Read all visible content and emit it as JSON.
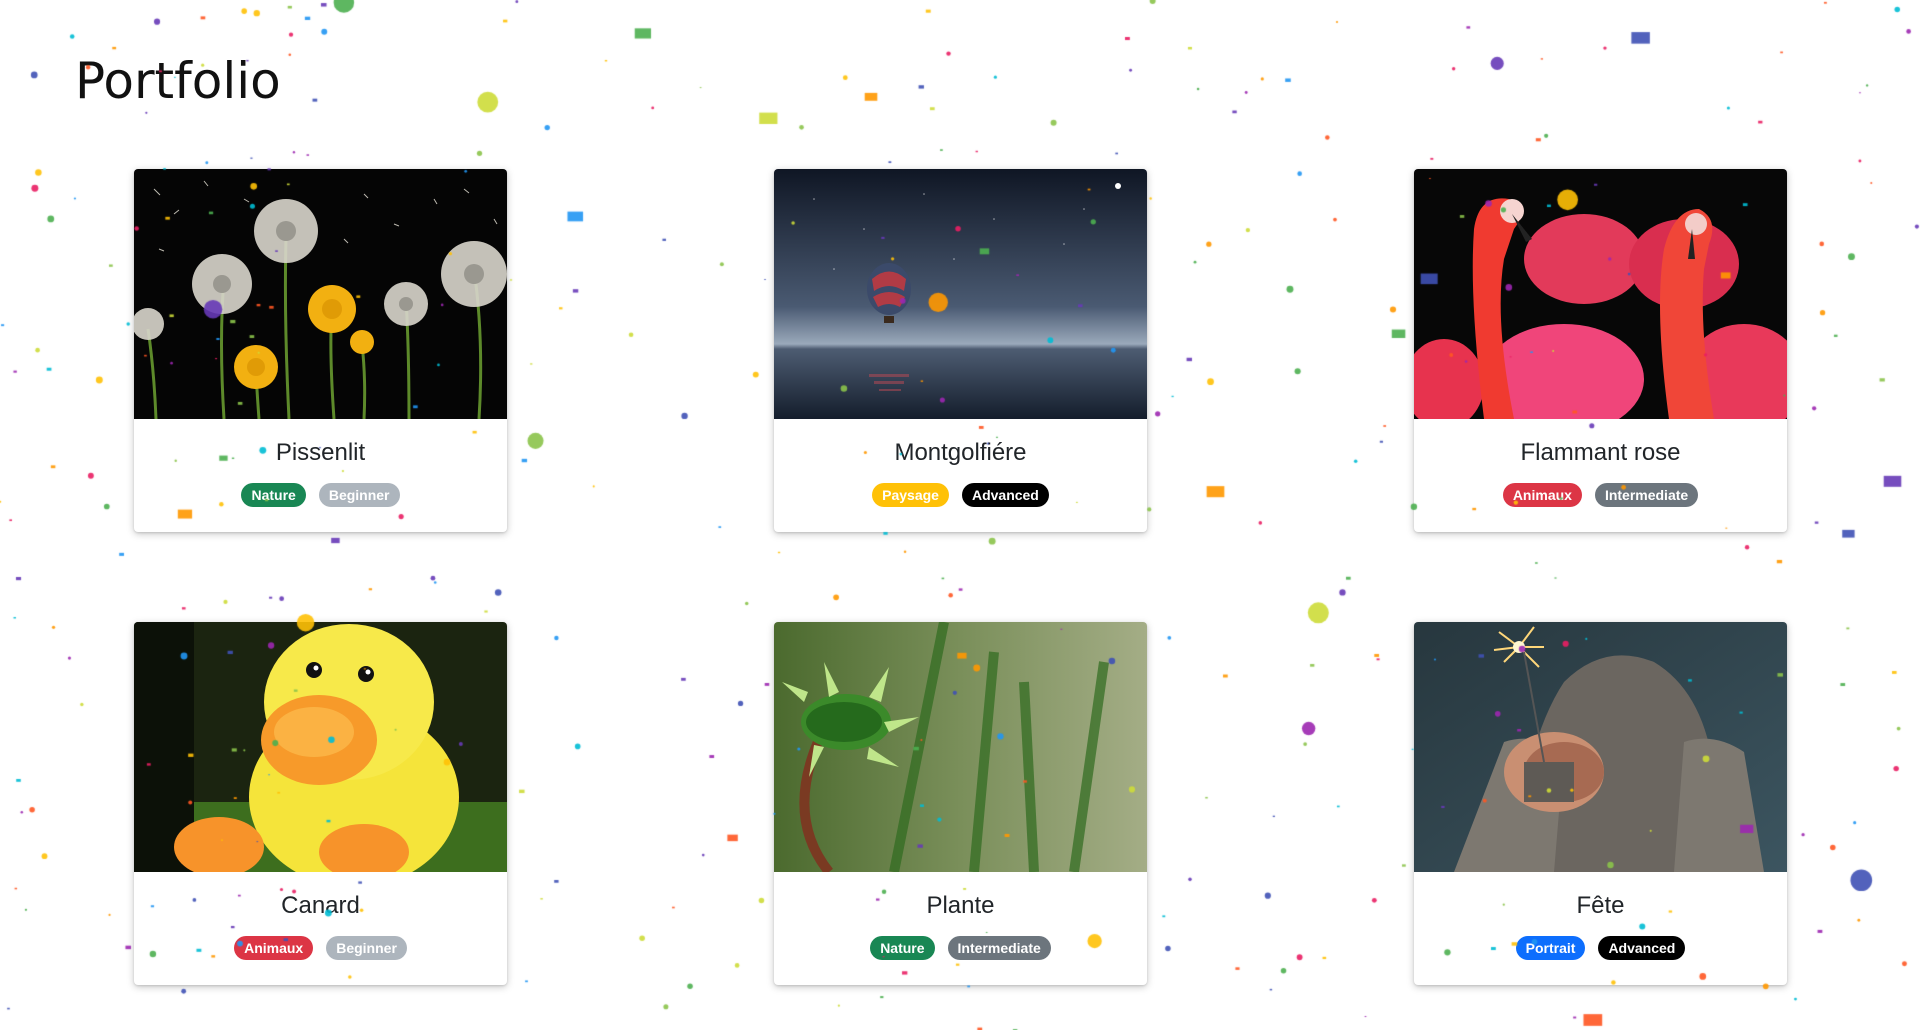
{
  "page": {
    "title": "Portfolio"
  },
  "badge_colors": {
    "Nature": "#198754",
    "Paysage": "#ffc107",
    "Animaux": "#dc3545",
    "Portrait": "#0d6efd",
    "Beginner": "#adb5bd",
    "Intermediate": "#6c757d",
    "Advanced": "#000000"
  },
  "cards": [
    {
      "title": "Pissenlit",
      "category": "Nature",
      "level": "Beginner",
      "image": "dandelions-photo"
    },
    {
      "title": "Montgolfiére",
      "category": "Paysage",
      "level": "Advanced",
      "image": "hot-air-balloon-photo"
    },
    {
      "title": "Flammant rose",
      "category": "Animaux",
      "level": "Intermediate",
      "image": "flamingos-photo"
    },
    {
      "title": "Canard",
      "category": "Animaux",
      "level": "Beginner",
      "image": "plush-duck-photo"
    },
    {
      "title": "Plante",
      "category": "Nature",
      "level": "Intermediate",
      "image": "plant-bud-photo"
    },
    {
      "title": "Fête",
      "category": "Portrait",
      "level": "Advanced",
      "image": "sparkler-photo"
    }
  ],
  "confetti_colors": [
    "#e91e63",
    "#9c27b0",
    "#3f51b5",
    "#2196f3",
    "#00bcd4",
    "#4caf50",
    "#8bc34a",
    "#ffc107",
    "#ff9800",
    "#ff5722",
    "#673ab7",
    "#cddc39"
  ]
}
